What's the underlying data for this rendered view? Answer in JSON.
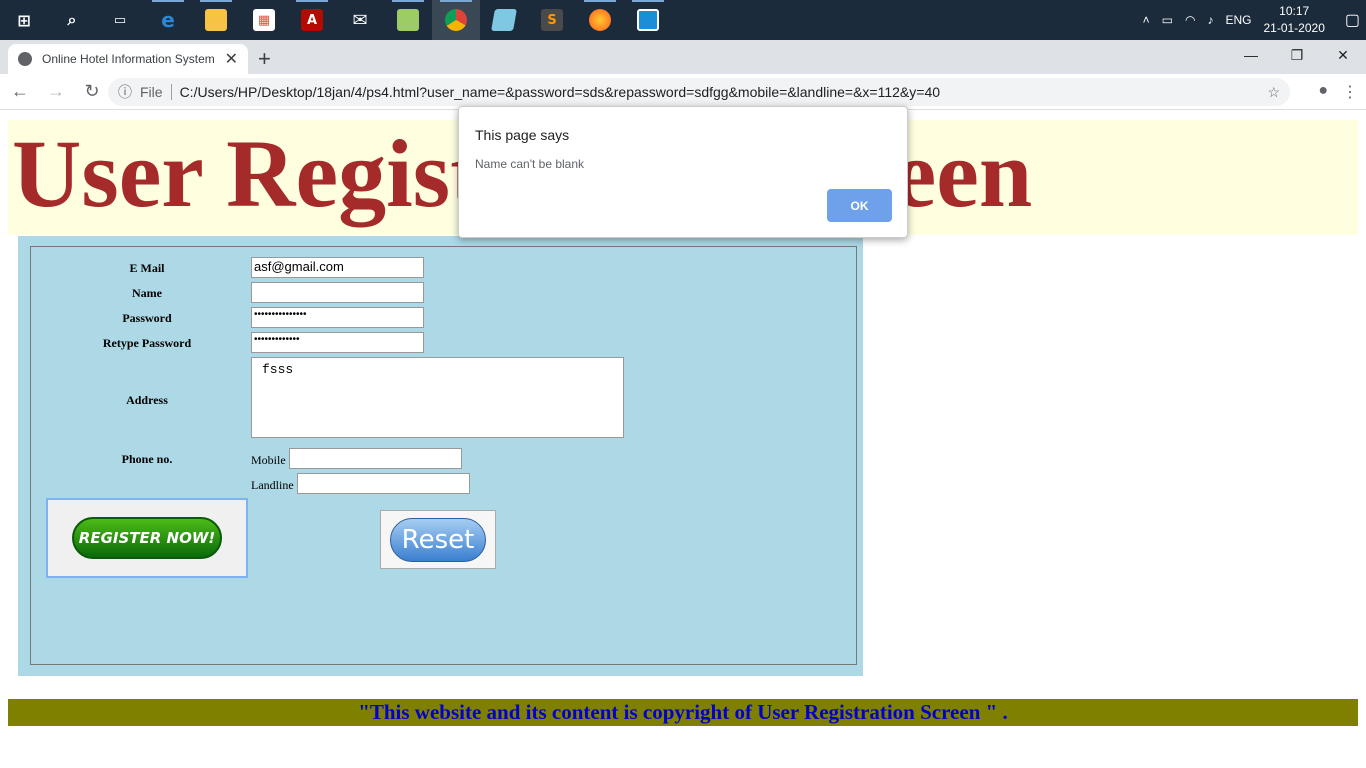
{
  "taskbar": {
    "icons": [
      "windows-start-icon",
      "search-icon",
      "task-view-icon",
      "edge-icon",
      "file-explorer-icon",
      "store-icon",
      "acrobat-icon",
      "mail-icon",
      "notepad-icon",
      "chrome-icon",
      "app-icon",
      "sublime-icon",
      "firefox-icon",
      "app-square-icon"
    ],
    "language": "ENG",
    "time": "10:17",
    "date": "21-01-2020"
  },
  "browser": {
    "tab_title": "Online Hotel Information System",
    "url_scheme": "File",
    "url": "C:/Users/HP/Desktop/18jan/4/ps4.html?user_name=&password=sds&repassword=sdfgg&mobile=&landline=&x=112&y=40"
  },
  "page": {
    "heading": "User Registration Screen",
    "form": {
      "email_label": "E Mail",
      "email_value": "asf@gmail.com",
      "name_label": "Name",
      "name_value": "",
      "password_label": "Password",
      "password_value": "•••••••••••••••",
      "retype_label": "Retype Password",
      "retype_value": "•••••••••••••",
      "address_label": "Address",
      "address_value": "fsss",
      "phone_label": "Phone no.",
      "mobile_label": "Mobile",
      "landline_label": "Landline",
      "register_label": "REGISTER NOW!",
      "reset_label": "Reset"
    },
    "footer": "\"This website and its content is copyright of User Registration Screen \" ."
  },
  "dialog": {
    "title": "This page says",
    "message": "Name can't be blank",
    "ok_label": "OK"
  }
}
